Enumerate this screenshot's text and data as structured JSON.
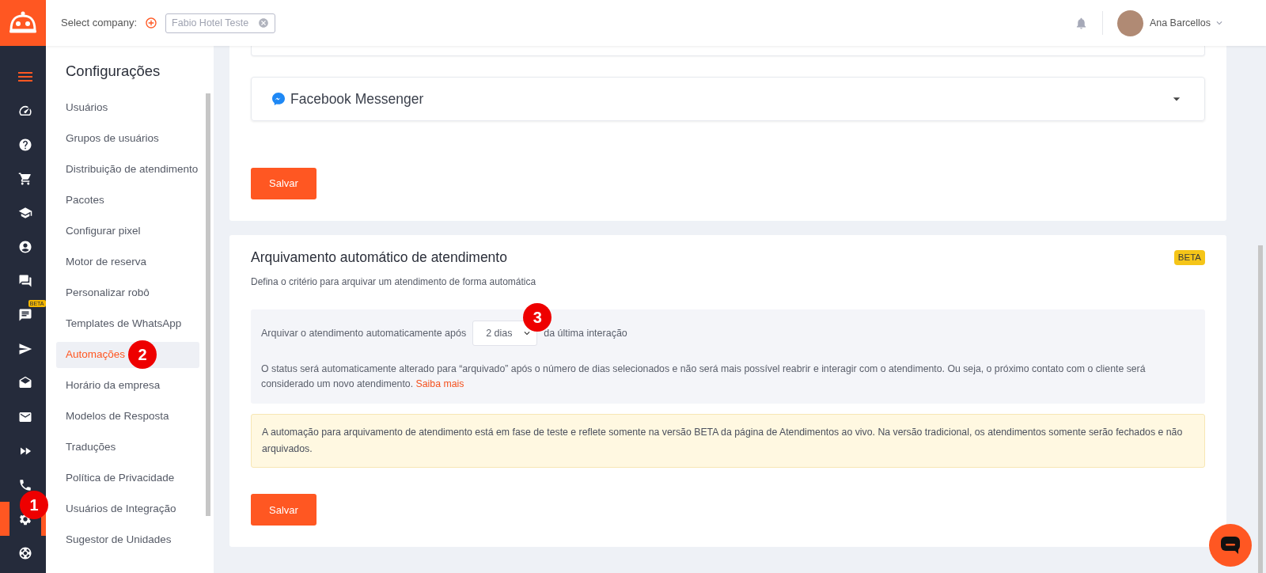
{
  "header": {
    "select_label": "Select company:",
    "company_tag": "Fabio Hotel Teste",
    "user_name": "Ana Barcellos"
  },
  "rail": {
    "items": [
      {
        "selected": false
      },
      {
        "selected": false
      },
      {
        "selected": false
      },
      {
        "selected": false
      },
      {
        "selected": false
      },
      {
        "selected": false
      },
      {
        "selected": false
      },
      {
        "selected": false,
        "badge": "BETA"
      },
      {
        "selected": false
      },
      {
        "selected": false
      },
      {
        "selected": false
      },
      {
        "selected": false
      },
      {
        "selected": false
      },
      {
        "selected": true,
        "marker": "1"
      },
      {
        "selected": false
      }
    ]
  },
  "settings_nav": {
    "title": "Configurações",
    "items": [
      {
        "label": "Usuários",
        "selected": false
      },
      {
        "label": "Grupos de usuários",
        "selected": false
      },
      {
        "label": "Distribuição de atendimento",
        "selected": false
      },
      {
        "label": "Pacotes",
        "selected": false
      },
      {
        "label": "Configurar pixel",
        "selected": false
      },
      {
        "label": "Motor de reserva",
        "selected": false
      },
      {
        "label": "Personalizar robô",
        "selected": false
      },
      {
        "label": "Templates de WhatsApp",
        "selected": false
      },
      {
        "label": "Automações",
        "selected": true,
        "marker": "2"
      },
      {
        "label": "Horário da empresa",
        "selected": false
      },
      {
        "label": "Modelos de Resposta",
        "selected": false
      },
      {
        "label": "Traduções",
        "selected": false
      },
      {
        "label": "Política de Privacidade",
        "selected": false
      },
      {
        "label": "Usuários de Integração",
        "selected": false
      },
      {
        "label": "Sugestor de Unidades",
        "selected": false
      }
    ]
  },
  "channels_card": {
    "messenger": {
      "title": "Facebook Messenger",
      "expanded": false
    },
    "button": "Salvar"
  },
  "archive_card": {
    "title": "Arquivamento automático de atendimento",
    "badge": "BETA",
    "subtitle": "Defina o critério para arquivar um atendimento de forma automática",
    "row_prefix": "Arquivar o atendimento automaticamente após",
    "select_value": "2 dias",
    "select_marker": "3",
    "row_suffix": "da última interação",
    "info_text": "O status será automaticamente alterado para “arquivado” após o número de dias selecionados e não será mais possível reabrir e interagir com o atendimento. Ou seja, o próximo contato com o cliente será considerado um novo atendimento.",
    "info_link": "Saiba mais",
    "notice": "A automação para arquivamento de atendimento está em fase de teste e reflete somente na versão BETA da página de Atendimentos ao vivo. Na versão tradicional, os atendimentos somente serão fechados e não arquivados.",
    "button": "Salvar"
  }
}
